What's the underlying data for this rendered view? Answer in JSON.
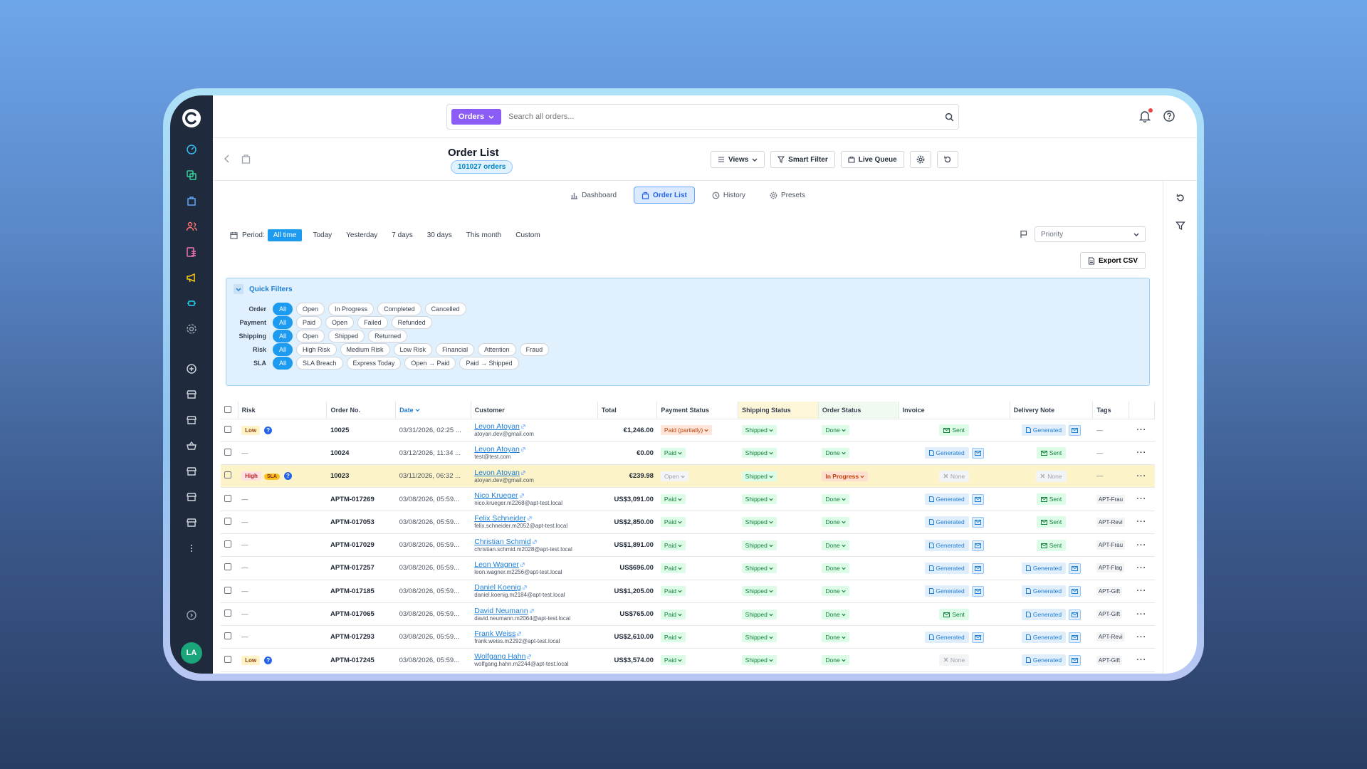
{
  "app": {
    "avatar_initials": "LA",
    "brand_color": "#1f2a3d",
    "accent": "#1d9bf0"
  },
  "sidebar": {
    "icons": [
      "dashboard-icon",
      "copy-icon",
      "orders-icon",
      "customers-icon",
      "content-icon",
      "marketing-icon",
      "extensions-icon",
      "settings-icon",
      "add-icon",
      "sales-channel-icon-1",
      "sales-channel-icon-2",
      "basket-icon",
      "sales-channel-icon-3",
      "sales-channel-icon-4",
      "sales-channel-icon-5",
      "more-icon",
      "help-icon"
    ]
  },
  "search": {
    "scope": "Orders",
    "placeholder": "Search all orders..."
  },
  "header": {
    "title": "Order List",
    "count": "101027 orders",
    "views": "Views",
    "smart_filter": "Smart Filter",
    "live_queue": "Live Queue"
  },
  "tabs": [
    {
      "label": "Dashboard"
    },
    {
      "label": "Order List"
    },
    {
      "label": "History"
    },
    {
      "label": "Presets"
    }
  ],
  "period": {
    "label": "Period:",
    "options": [
      "All time",
      "Today",
      "Yesterday",
      "7 days",
      "30 days",
      "This month",
      "Custom"
    ]
  },
  "priority": {
    "value": "Priority"
  },
  "export_label": "Export CSV",
  "quick_filters": {
    "title": "Quick Filters",
    "rows": [
      {
        "label": "Order",
        "chips": [
          "All",
          "Open",
          "In Progress",
          "Completed",
          "Cancelled"
        ]
      },
      {
        "label": "Payment",
        "chips": [
          "All",
          "Paid",
          "Open",
          "Failed",
          "Refunded"
        ]
      },
      {
        "label": "Shipping",
        "chips": [
          "All",
          "Open",
          "Shipped",
          "Returned"
        ]
      },
      {
        "label": "Risk",
        "chips": [
          "All",
          "High Risk",
          "Medium Risk",
          "Low Risk",
          "Financial",
          "Attention",
          "Fraud"
        ]
      },
      {
        "label": "SLA",
        "chips": [
          "All",
          "SLA Breach",
          "Express Today",
          "Open → Paid",
          "Paid → Shipped"
        ]
      }
    ]
  },
  "table": {
    "headers": [
      "Risk",
      "Order No.",
      "Date",
      "Customer",
      "Total",
      "Payment Status",
      "Shipping Status",
      "Order Status",
      "Invoice",
      "Delivery Note",
      "Tags"
    ],
    "rows": [
      {
        "risk": "Low",
        "help": true,
        "sla": false,
        "order": "10025",
        "date": "03/31/2026, 02:25 ...",
        "name": "Levon Atoyan",
        "email": "atoyan.dev@gmail.com",
        "total": "€1,246.00",
        "payment": "Paid (partially)",
        "shipping": "Shipped",
        "status": "Done",
        "invoice": "Sent",
        "invoice_mail": false,
        "delivery": "Generated",
        "delivery_mail": true,
        "tag": "—"
      },
      {
        "risk": "—",
        "help": false,
        "sla": false,
        "order": "10024",
        "date": "03/12/2026, 11:34 ...",
        "name": "Levon Atoyan",
        "email": "test@test.com",
        "total": "€0.00",
        "payment": "Paid",
        "shipping": "Shipped",
        "status": "Done",
        "invoice": "Generated",
        "invoice_mail": true,
        "delivery": "Sent",
        "delivery_mail": false,
        "tag": "—"
      },
      {
        "risk": "High",
        "help": true,
        "sla": true,
        "sla_label": "SLA",
        "order": "10023",
        "date": "03/11/2026, 06:32 ...",
        "name": "Levon Atoyan",
        "email": "atoyan.dev@gmail.com",
        "total": "€239.98",
        "payment": "Open",
        "shipping": "Shipped",
        "status": "In Progress",
        "invoice": "None",
        "invoice_mail": false,
        "delivery": "None",
        "delivery_mail": false,
        "tag": "—"
      },
      {
        "risk": "—",
        "help": false,
        "sla": false,
        "order": "APTM-017269",
        "date": "03/08/2026, 05:59...",
        "name": "Nico Krueger",
        "email": "nico.krueger.m2268@apt-test.local",
        "total": "US$3,091.00",
        "payment": "Paid",
        "shipping": "Shipped",
        "status": "Done",
        "invoice": "Generated",
        "invoice_mail": true,
        "delivery": "Sent",
        "delivery_mail": false,
        "tag": "APT-Frau"
      },
      {
        "risk": "—",
        "help": false,
        "sla": false,
        "order": "APTM-017053",
        "date": "03/08/2026, 05:59...",
        "name": "Felix Schneider",
        "email": "felix.schneider.m2052@apt-test.local",
        "total": "US$2,850.00",
        "payment": "Paid",
        "shipping": "Shipped",
        "status": "Done",
        "invoice": "Generated",
        "invoice_mail": true,
        "delivery": "Sent",
        "delivery_mail": false,
        "tag": "APT-Revi"
      },
      {
        "risk": "—",
        "help": false,
        "sla": false,
        "order": "APTM-017029",
        "date": "03/08/2026, 05:59...",
        "name": "Christian Schmid",
        "email": "christian.schmid.m2028@apt-test.local",
        "total": "US$1,891.00",
        "payment": "Paid",
        "shipping": "Shipped",
        "status": "Done",
        "invoice": "Generated",
        "invoice_mail": true,
        "delivery": "Sent",
        "delivery_mail": false,
        "tag": "APT-Frau"
      },
      {
        "risk": "—",
        "help": false,
        "sla": false,
        "order": "APTM-017257",
        "date": "03/08/2026, 05:59...",
        "name": "Leon Wagner",
        "email": "leon.wagner.m2256@apt-test.local",
        "total": "US$696.00",
        "payment": "Paid",
        "shipping": "Shipped",
        "status": "Done",
        "invoice": "Generated",
        "invoice_mail": true,
        "delivery": "Generated",
        "delivery_mail": true,
        "tag": "APT-Flag"
      },
      {
        "risk": "—",
        "help": false,
        "sla": false,
        "order": "APTM-017185",
        "date": "03/08/2026, 05:59...",
        "name": "Daniel Koenig",
        "email": "daniel.koenig.m2184@apt-test.local",
        "total": "US$1,205.00",
        "payment": "Paid",
        "shipping": "Shipped",
        "status": "Done",
        "invoice": "Generated",
        "invoice_mail": true,
        "delivery": "Generated",
        "delivery_mail": true,
        "tag": "APT-Gift"
      },
      {
        "risk": "—",
        "help": false,
        "sla": false,
        "order": "APTM-017065",
        "date": "03/08/2026, 05:59...",
        "name": "David Neumann",
        "email": "david.neumann.m2064@apt-test.local",
        "total": "US$765.00",
        "payment": "Paid",
        "shipping": "Shipped",
        "status": "Done",
        "invoice": "Sent",
        "invoice_mail": false,
        "delivery": "Generated",
        "delivery_mail": true,
        "tag": "APT-Gift"
      },
      {
        "risk": "—",
        "help": false,
        "sla": false,
        "order": "APTM-017293",
        "date": "03/08/2026, 05:59...",
        "name": "Frank Weiss",
        "email": "frank.weiss.m2292@apt-test.local",
        "total": "US$2,610.00",
        "payment": "Paid",
        "shipping": "Shipped",
        "status": "Done",
        "invoice": "Generated",
        "invoice_mail": true,
        "delivery": "Generated",
        "delivery_mail": true,
        "tag": "APT-Revi"
      },
      {
        "risk": "Low",
        "help": true,
        "sla": false,
        "order": "APTM-017245",
        "date": "03/08/2026, 05:59...",
        "name": "Wolfgang Hahn",
        "email": "wolfgang.hahn.m2244@apt-test.local",
        "total": "US$3,574.00",
        "payment": "Paid",
        "shipping": "Shipped",
        "status": "Done",
        "invoice": "None",
        "invoice_mail": false,
        "delivery": "Generated",
        "delivery_mail": true,
        "tag": "APT-Gift"
      }
    ]
  }
}
